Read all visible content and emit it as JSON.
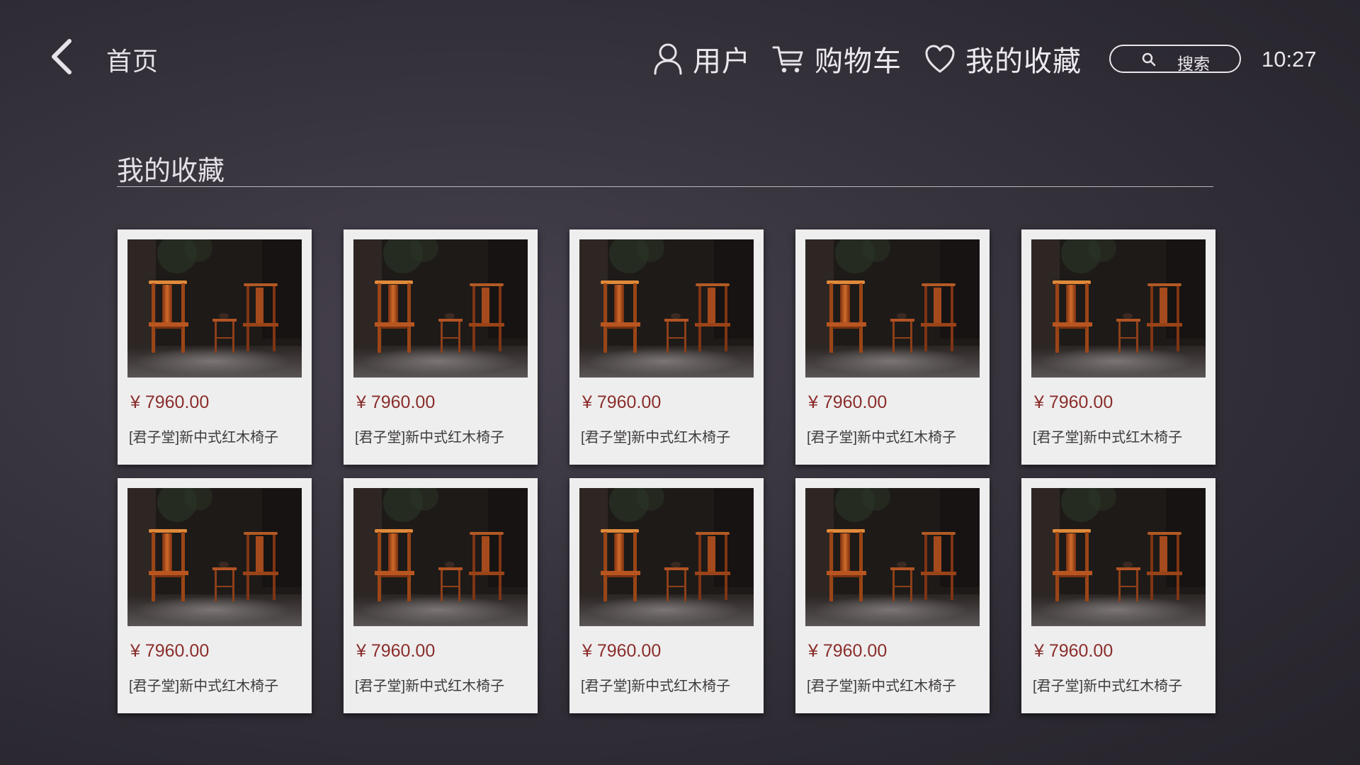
{
  "header": {
    "home_label": "首页",
    "nav": [
      {
        "label": "用户",
        "icon": "user-icon"
      },
      {
        "label": "购物车",
        "icon": "cart-icon"
      },
      {
        "label": "我的收藏",
        "icon": "heart-icon"
      }
    ],
    "search_label": "搜索",
    "clock": "10:27"
  },
  "section": {
    "title": "我的收藏"
  },
  "colors": {
    "price": "#8a2e2c",
    "card_bg": "#efeeee"
  },
  "products": [
    {
      "price": "¥ 7960.00",
      "name": "[君子堂]新中式红木椅子",
      "image": "chair-set-photo"
    },
    {
      "price": "¥ 7960.00",
      "name": "[君子堂]新中式红木椅子",
      "image": "chair-set-photo"
    },
    {
      "price": "¥ 7960.00",
      "name": "[君子堂]新中式红木椅子",
      "image": "chair-set-photo"
    },
    {
      "price": "¥ 7960.00",
      "name": "[君子堂]新中式红木椅子",
      "image": "chair-set-photo"
    },
    {
      "price": "¥ 7960.00",
      "name": "[君子堂]新中式红木椅子",
      "image": "chair-set-photo"
    },
    {
      "price": "¥ 7960.00",
      "name": "[君子堂]新中式红木椅子",
      "image": "chair-set-photo"
    },
    {
      "price": "¥ 7960.00",
      "name": "[君子堂]新中式红木椅子",
      "image": "chair-set-photo"
    },
    {
      "price": "¥ 7960.00",
      "name": "[君子堂]新中式红木椅子",
      "image": "chair-set-photo"
    },
    {
      "price": "¥ 7960.00",
      "name": "[君子堂]新中式红木椅子",
      "image": "chair-set-photo"
    },
    {
      "price": "¥ 7960.00",
      "name": "[君子堂]新中式红木椅子",
      "image": "chair-set-photo"
    }
  ]
}
